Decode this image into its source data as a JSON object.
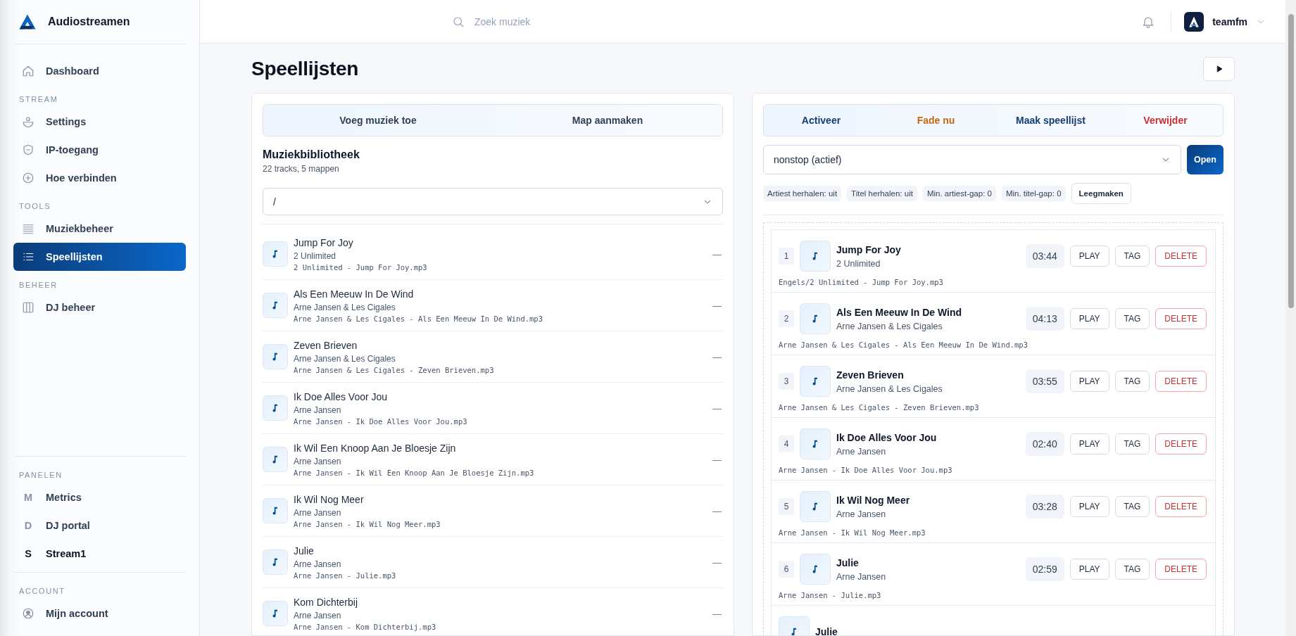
{
  "brand": {
    "name": "Audiostreamen"
  },
  "nav": [
    {
      "items": [
        {
          "kind": "icon",
          "label": "Dashboard",
          "selected": false
        }
      ]
    },
    {
      "heading": "STREAM",
      "items": [
        {
          "kind": "icon",
          "label": "Settings",
          "selected": false
        },
        {
          "kind": "icon",
          "label": "IP-toegang",
          "selected": false
        },
        {
          "kind": "icon",
          "label": "Hoe verbinden",
          "selected": false
        }
      ]
    },
    {
      "heading": "TOOLS",
      "items": [
        {
          "kind": "icon",
          "label": "Muziekbeheer",
          "selected": false
        },
        {
          "kind": "icon",
          "label": "Speellijsten",
          "selected": true
        }
      ]
    },
    {
      "heading": "BEHEER",
      "items": [
        {
          "kind": "icon",
          "label": "DJ beheer",
          "selected": false
        }
      ]
    }
  ],
  "bottom_nav": [
    {
      "heading": "PANELEN",
      "items": [
        {
          "kind": "letter",
          "letter": "M",
          "label": "Metrics",
          "active": false
        },
        {
          "kind": "letter",
          "letter": "D",
          "label": "DJ portal",
          "active": false
        },
        {
          "kind": "letter",
          "letter": "S",
          "label": "Stream1",
          "active": true
        }
      ]
    },
    {
      "heading": "ACCOUNT",
      "items": [
        {
          "kind": "icon",
          "label": "Mijn account",
          "active": false
        }
      ]
    }
  ],
  "header": {
    "search": {
      "placeholder": "Zoek muziek"
    },
    "user": "teamfm"
  },
  "page_title": "Speellijsten",
  "library": {
    "tabs": [
      "Voeg muziek toe",
      "Map aanmaken"
    ],
    "title": "Muziekbibliotheek",
    "summary": "22 tracks, 5 mappen",
    "folder": {
      "value": "/"
    },
    "tracks": [
      {
        "title": "Jump For Joy",
        "artist": "2 Unlimited",
        "file": "2 Unlimited - Jump For Joy.mp3",
        "action": "—"
      },
      {
        "title": "Als Een Meeuw In De Wind",
        "artist": "Arne Jansen & Les Cigales",
        "file": "Arne Jansen & Les Cigales - Als Een Meeuw In De Wind.mp3",
        "action": "—"
      },
      {
        "title": "Zeven Brieven",
        "artist": "Arne Jansen & Les Cigales",
        "file": "Arne Jansen & Les Cigales - Zeven Brieven.mp3",
        "action": "—"
      },
      {
        "title": "Ik Doe Alles Voor Jou",
        "artist": "Arne Jansen",
        "file": "Arne Jansen - Ik Doe Alles Voor Jou.mp3",
        "action": "—"
      },
      {
        "title": "Ik Wil Een Knoop Aan Je Bloesje Zijn",
        "artist": "Arne Jansen",
        "file": "Arne Jansen - Ik Wil Een Knoop Aan Je Bloesje Zijn.mp3",
        "action": "—"
      },
      {
        "title": "Ik Wil Nog Meer",
        "artist": "Arne Jansen",
        "file": "Arne Jansen - Ik Wil Nog Meer.mp3",
        "action": "—"
      },
      {
        "title": "Julie",
        "artist": "Arne Jansen",
        "file": "Arne Jansen - Julie.mp3",
        "action": "—"
      },
      {
        "title": "Kom Dichterbij",
        "artist": "Arne Jansen",
        "file": "Arne Jansen - Kom Dichterbij.mp3",
        "action": "—"
      }
    ]
  },
  "playlist": {
    "actions": [
      {
        "label": "Activeer",
        "kind": "primary"
      },
      {
        "label": "Fade nu",
        "kind": "warning"
      },
      {
        "label": "Maak speellijst",
        "kind": "primary"
      },
      {
        "label": "Verwijder",
        "kind": "danger"
      }
    ],
    "select": {
      "value": "nonstop (actief)"
    },
    "open_button": "Open",
    "chips": [
      "Artiest herhalen: uit",
      "Titel herhalen: uit",
      "Min. artiest-gap: 0",
      "Min. titel-gap: 0"
    ],
    "clear_button": "Leegmaken",
    "tracks": [
      {
        "number": "1",
        "title": "Jump For Joy",
        "artist": "2 Unlimited",
        "duration": "03:44",
        "file": "Engels/2 Unlimited - Jump For Joy.mp3",
        "buttons": [
          {
            "label": "PLAY",
            "kind": "default"
          },
          {
            "label": "TAG",
            "kind": "default"
          },
          {
            "label": "DELETE",
            "kind": "danger"
          }
        ]
      },
      {
        "number": "2",
        "title": "Als Een Meeuw In De Wind",
        "artist": "Arne Jansen & Les Cigales",
        "duration": "04:13",
        "file": "Arne Jansen & Les Cigales - Als Een Meeuw In De Wind.mp3",
        "buttons": [
          {
            "label": "PLAY",
            "kind": "default"
          },
          {
            "label": "TAG",
            "kind": "default"
          },
          {
            "label": "DELETE",
            "kind": "danger"
          }
        ]
      },
      {
        "number": "3",
        "title": "Zeven Brieven",
        "artist": "Arne Jansen & Les Cigales",
        "duration": "03:55",
        "file": "Arne Jansen & Les Cigales - Zeven Brieven.mp3",
        "buttons": [
          {
            "label": "PLAY",
            "kind": "default"
          },
          {
            "label": "TAG",
            "kind": "default"
          },
          {
            "label": "DELETE",
            "kind": "danger"
          }
        ]
      },
      {
        "number": "4",
        "title": "Ik Doe Alles Voor Jou",
        "artist": "Arne Jansen",
        "duration": "02:40",
        "file": "Arne Jansen - Ik Doe Alles Voor Jou.mp3",
        "buttons": [
          {
            "label": "PLAY",
            "kind": "default"
          },
          {
            "label": "TAG",
            "kind": "default"
          },
          {
            "label": "DELETE",
            "kind": "danger"
          }
        ]
      },
      {
        "number": "5",
        "title": "Ik Wil Nog Meer",
        "artist": "Arne Jansen",
        "duration": "03:28",
        "file": "Arne Jansen - Ik Wil Nog Meer.mp3",
        "buttons": [
          {
            "label": "PLAY",
            "kind": "default"
          },
          {
            "label": "TAG",
            "kind": "default"
          },
          {
            "label": "DELETE",
            "kind": "danger"
          }
        ]
      },
      {
        "number": "6",
        "title": "Julie",
        "artist": "Arne Jansen",
        "duration": "02:59",
        "file": "Arne Jansen - Julie.mp3",
        "buttons": [
          {
            "label": "PLAY",
            "kind": "default"
          },
          {
            "label": "TAG",
            "kind": "default"
          },
          {
            "label": "DELETE",
            "kind": "danger"
          }
        ]
      },
      {
        "title": "Julie"
      }
    ]
  }
}
